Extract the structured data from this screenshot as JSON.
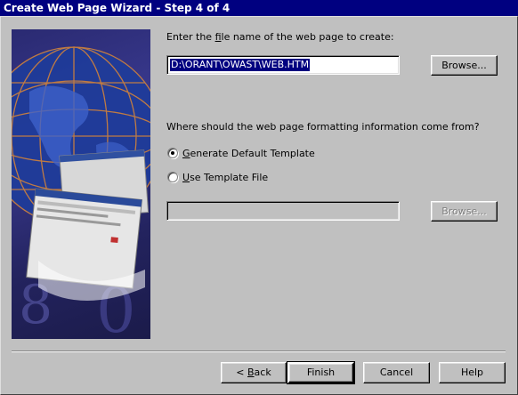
{
  "window": {
    "title": "Create Web Page Wizard - Step 4 of 4"
  },
  "filename": {
    "prompt_pre": "Enter the ",
    "prompt_hot": "f",
    "prompt_post": "ile name of the web page to create:",
    "value": "D:\\ORANT\\OWAST\\WEB.HTM",
    "browse_label": "Browse..."
  },
  "formatting": {
    "question": "Where should the web page formatting information come from?",
    "options": [
      {
        "hot": "G",
        "rest": "enerate Default Template",
        "selected": true
      },
      {
        "hot": "U",
        "rest": "se Template File",
        "selected": false
      }
    ],
    "template_value": "",
    "browse_label": "Browse..."
  },
  "footer": {
    "back_hot": "B",
    "back_pre": "< ",
    "back_rest": "ack",
    "finish_label": "Finish",
    "cancel_label": "Cancel",
    "help_label": "Help"
  }
}
